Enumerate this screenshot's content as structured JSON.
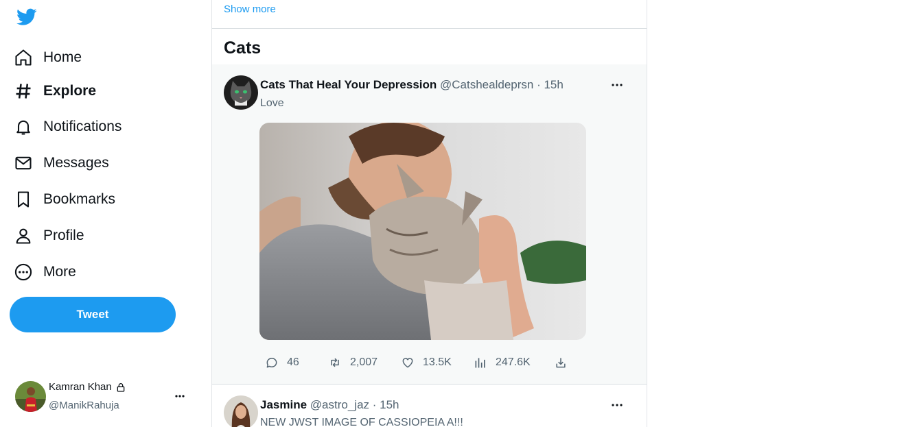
{
  "sidebar": {
    "logo": "twitter-bird-icon",
    "items": [
      {
        "label": "Home",
        "icon": "home-icon"
      },
      {
        "label": "Explore",
        "icon": "hashtag-icon"
      },
      {
        "label": "Notifications",
        "icon": "bell-icon"
      },
      {
        "label": "Messages",
        "icon": "envelope-icon"
      },
      {
        "label": "Bookmarks",
        "icon": "bookmark-icon"
      },
      {
        "label": "Profile",
        "icon": "person-icon"
      },
      {
        "label": "More",
        "icon": "more-circle-icon"
      }
    ],
    "active": "Explore",
    "tweet_button": "Tweet",
    "account": {
      "name": "Kamran Khan",
      "handle": "@ManikRahuja",
      "locked": true
    }
  },
  "main": {
    "show_more": "Show more",
    "section_title": "Cats",
    "tweets": [
      {
        "name": "Cats That Heal Your Depression",
        "handle": "@Catshealdeprsn",
        "time": "· 15h",
        "text": "Love",
        "replies": "46",
        "retweets": "2,007",
        "likes": "13.5K",
        "views": "247.6K"
      },
      {
        "name": "Jasmine",
        "handle": "@astro_jaz",
        "time": "· 15h",
        "text": "NEW JWST IMAGE OF CASSIOPEIA A!!!"
      }
    ]
  },
  "colors": {
    "accent": "#1d9bf0",
    "text": "#0f1419",
    "muted": "#536471"
  }
}
